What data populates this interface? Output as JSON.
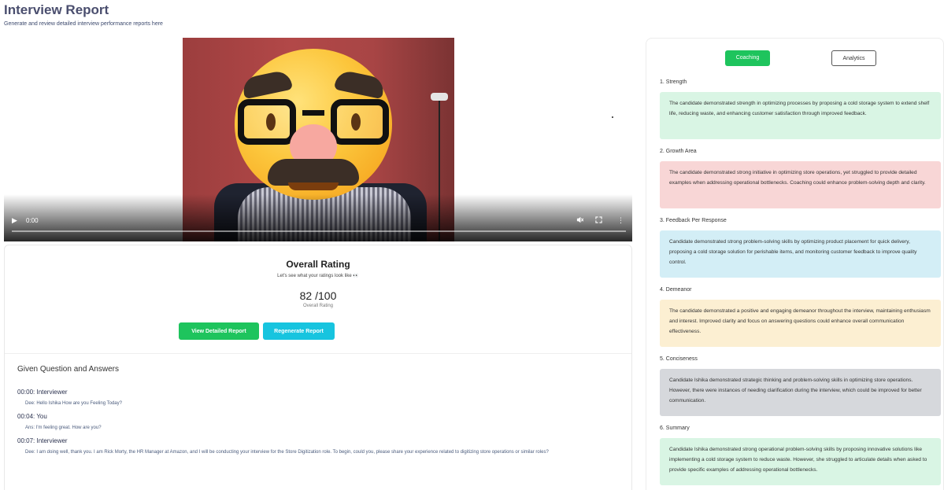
{
  "page": {
    "title": "Interview Report",
    "subtitle": "Generate and review detailed interview performance reports here"
  },
  "video": {
    "time": "0:00",
    "play_icon": "play-icon",
    "mute_icon": "mute-icon",
    "fullscreen_icon": "fullscreen-icon",
    "more_icon": "more-options-icon",
    "progress": 0
  },
  "rating": {
    "title": "Overall Rating",
    "subtitle": "Let's see what your ratings look like 👀",
    "score": "82 /100",
    "score_label": "Overall Rating",
    "view_button": "View Detailed Report",
    "regenerate_button": "Regenerate Report"
  },
  "qa": {
    "title": "Given Question and Answers",
    "items": [
      {
        "speaker": "00:00: Interviewer",
        "text": "Dee: Hello Ishika How are you Feeling Today?"
      },
      {
        "speaker": "00:04: You",
        "text": "Ans: I'm feeling great. How are you?"
      },
      {
        "speaker": "00:07: Interviewer",
        "text": "Dee: I am doing well, thank you. I am Rick Morty, the HR Manager at Amazon, and I will be conducting your interview for the Store Digitization role. To begin, could you, please share your experience related to digitizing store operations or similar roles?"
      }
    ]
  },
  "coaching": {
    "tabs": {
      "coaching": "Coaching",
      "analytics": "Analytics"
    },
    "sections": [
      {
        "title": "1. Strength",
        "color": "#d9f5e4",
        "text": "The candidate demonstrated strength in optimizing processes by proposing a cold storage system to extend shelf life, reducing waste, and enhancing customer satisfaction through improved feedback."
      },
      {
        "title": "2. Growth Area",
        "color": "#f8d6d6",
        "text": "The candidate demonstrated strong initiative in optimizing store operations, yet struggled to provide detailed examples when addressing operational bottlenecks. Coaching could enhance problem-solving depth and clarity."
      },
      {
        "title": "3. Feedback Per Response",
        "color": "#d3eef6",
        "text": "Candidate demonstrated strong problem-solving skills by optimizing product placement for quick delivery, proposing a cold storage solution for perishable items, and monitoring customer feedback to improve quality control."
      },
      {
        "title": "4. Demeanor",
        "color": "#fcefd2",
        "text": "The candidate demonstrated a positive and engaging demeanor throughout the interview, maintaining enthusiasm and interest. Improved clarity and focus on answering questions could enhance overall communication effectiveness."
      },
      {
        "title": "5. Conciseness",
        "color": "#d6d8dc",
        "text": "Candidate Ishika demonstrated strategic thinking and problem-solving skills in optimizing store operations. However, there were instances of needing clarification during the interview, which could be improved for better communication."
      },
      {
        "title": "6. Summary",
        "color": "#d9f5e4",
        "text": "Candidate Ishika demonstrated strong operational problem-solving skills by proposing innovative solutions like implementing a cold storage system to reduce waste. However, she struggled to articulate details when asked to provide specific examples of addressing operational bottlenecks."
      }
    ]
  }
}
